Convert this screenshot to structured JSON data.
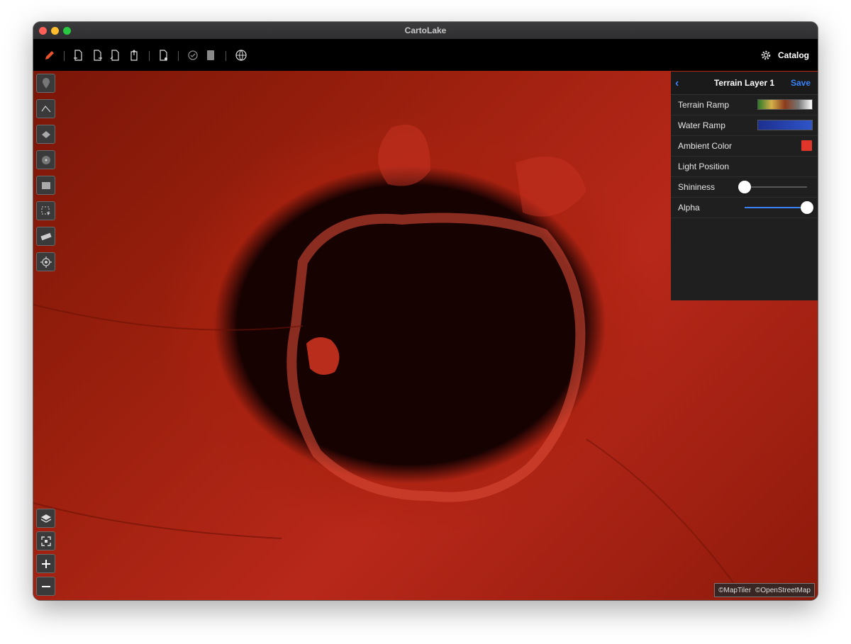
{
  "window": {
    "title": "CartoLake"
  },
  "toolbar": {
    "icons": [
      "pencil-icon",
      "import-icon",
      "export-icon",
      "export-image-icon",
      "share-icon",
      "document-icon",
      "validate-icon",
      "delete-icon",
      "globe-pin-icon"
    ],
    "catalog_label": "Catalog",
    "accent": "#e8532c"
  },
  "left_tools": [
    "point-tool-icon",
    "line-tool-icon",
    "polygon-tool-icon",
    "circle-tool-icon",
    "rectangle-tool-icon",
    "select-tool-icon",
    "measure-tool-icon",
    "locate-icon"
  ],
  "map_controls": [
    "layers-icon",
    "fit-bounds-icon",
    "zoom-in-icon",
    "zoom-out-icon"
  ],
  "panel": {
    "title": "Terrain Layer 1",
    "save_label": "Save",
    "rows": {
      "terrain_ramp": "Terrain Ramp",
      "water_ramp": "Water Ramp",
      "ambient_color": "Ambient Color",
      "light_position": "Light Position",
      "shininess": "Shininess",
      "alpha": "Alpha"
    },
    "ambient_color_value": "#e0352b",
    "shininess_value": 0.0,
    "alpha_value": 1.0
  },
  "attribution": {
    "maptiler": "©MapTiler",
    "osm": "©OpenStreetMap"
  }
}
